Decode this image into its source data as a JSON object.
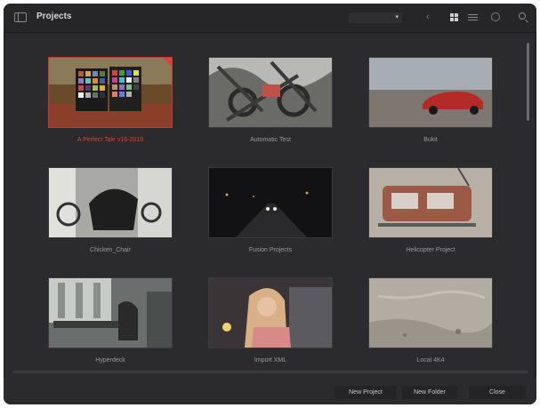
{
  "header": {
    "title": "Projects",
    "sort_value": "",
    "icons": [
      "sidebar-toggle-icon",
      "chevron-left-icon",
      "grid-view-icon",
      "list-view-icon",
      "info-icon",
      "search-icon"
    ]
  },
  "projects": [
    {
      "name": "A Perfect Tale v16-2019",
      "selected": true
    },
    {
      "name": "Automatic Test",
      "selected": false
    },
    {
      "name": "Bukit",
      "selected": false
    },
    {
      "name": "Chicken_Chair",
      "selected": false
    },
    {
      "name": "Fusion Projects",
      "selected": false
    },
    {
      "name": "Helicopter Project",
      "selected": false
    },
    {
      "name": "Hyperdeck",
      "selected": false
    },
    {
      "name": "Import XML",
      "selected": false
    },
    {
      "name": "Local 4K4",
      "selected": false
    }
  ],
  "footer": {
    "new_project": "New Project",
    "new_folder": "New Folder",
    "close": "Close"
  },
  "colors": {
    "window_bg": "#2b2b2d",
    "selected_accent": "#d6453a",
    "label_text": "#9a9a9d"
  }
}
